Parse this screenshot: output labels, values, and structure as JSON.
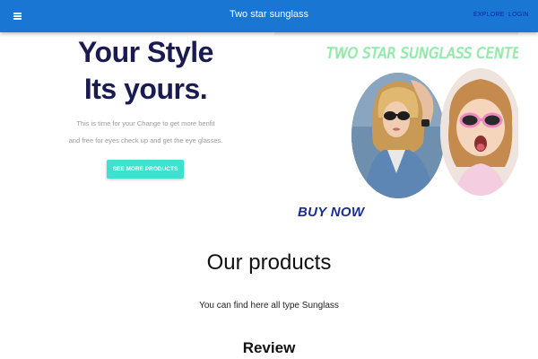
{
  "appbar": {
    "title": "Two star sunglass",
    "menu_icon": "menu-icon",
    "nav": [
      {
        "label": "EXPLORE"
      },
      {
        "label": "LOGIN"
      }
    ],
    "colors": {
      "background": "#1976d2",
      "nav_link": "#0d1fa8",
      "title": "#ffffff"
    }
  },
  "hero": {
    "title_line1": "Your Style",
    "title_line2": "Its yours.",
    "subtitle_line1": "This is time for your Change to get more benfit",
    "subtitle_line2": "and free for eyes check up and get the eye glasses.",
    "cta_label": "SEE MORE PRODUCTS",
    "colors": {
      "title": "#1a1b50",
      "subtitle": "#9a9a9a",
      "cta_background": "#40e0d0"
    }
  },
  "banner": {
    "heading": "TWO STAR SUNGLASS CENTER",
    "buy_now": "BUY NOW",
    "images": [
      {
        "subject": "woman wearing sunglasses",
        "icon": "woman-sunglasses-image"
      },
      {
        "subject": "surprised girl wearing pink sunglasses",
        "icon": "girl-sunglasses-image"
      }
    ],
    "colors": {
      "heading": "#8ef0a8",
      "buy_now": "#1c2f8f"
    }
  },
  "products": {
    "title": "Our products",
    "subtitle": "You can find here all type Sunglass"
  },
  "review": {
    "title": "Review"
  }
}
